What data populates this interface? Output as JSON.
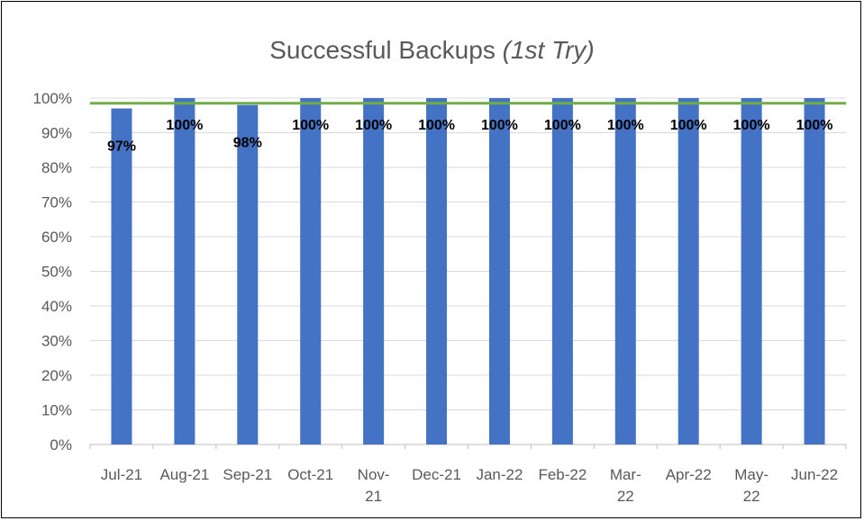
{
  "chart_data": {
    "type": "bar",
    "title": "Successful Backups",
    "title_suffix": "(1st Try)",
    "categories": [
      "Jul-21",
      "Aug-21",
      "Sep-21",
      "Oct-21",
      "Nov-21",
      "Dec-21",
      "Jan-22",
      "Feb-22",
      "Mar-22",
      "Apr-22",
      "May-22",
      "Jun-22"
    ],
    "values": [
      97,
      100,
      98,
      100,
      100,
      100,
      100,
      100,
      100,
      100,
      100,
      100
    ],
    "data_labels": [
      "97%",
      "100%",
      "98%",
      "100%",
      "100%",
      "100%",
      "100%",
      "100%",
      "100%",
      "100%",
      "100%",
      "100%"
    ],
    "y_ticks": [
      "0%",
      "10%",
      "20%",
      "30%",
      "40%",
      "50%",
      "60%",
      "70%",
      "80%",
      "90%",
      "100%"
    ],
    "target_line": 98.5,
    "ylim": [
      0,
      100
    ],
    "xlabel": "",
    "ylabel": "",
    "grid": true,
    "legend": "none",
    "colors": {
      "bar": "#4472C4",
      "target": "#70AD47",
      "grid": "#D9D9D9",
      "text": "#595959"
    }
  }
}
